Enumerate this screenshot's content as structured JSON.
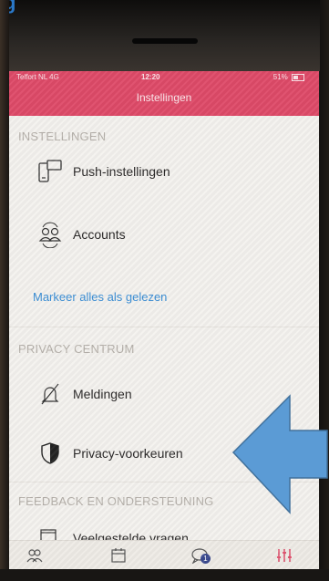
{
  "status_bar": {
    "carrier": "Telfort NL  4G",
    "time": "12:20",
    "battery": "51%"
  },
  "nav": {
    "title": "Instellingen"
  },
  "sections": {
    "settings_header": "INSTELLINGEN",
    "privacy_header": "PRIVACY CENTRUM",
    "feedback_header": "FEEDBACK EN ONDERSTEUNING"
  },
  "rows": {
    "push": "Push-instellingen",
    "accounts": "Accounts",
    "mark_all_read": "Markeer alles als gelezen",
    "notifications": "Meldingen",
    "privacy_prefs": "Privacy-voorkeuren",
    "faq": "Veelgestelde vragen"
  },
  "tabbar": {
    "chat_badge": "1",
    "active_tab": "settings",
    "accent_color": "#de4a68"
  },
  "colors": {
    "header": "#de4a68",
    "link": "#3a8ed6",
    "arrow": "#5b9bd5"
  }
}
